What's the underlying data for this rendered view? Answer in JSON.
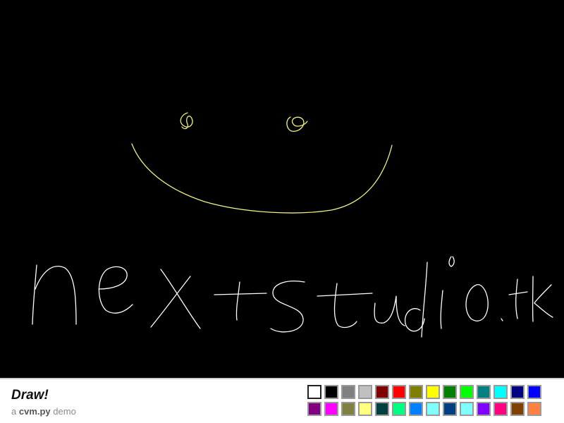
{
  "app": {
    "title": "Draw!",
    "subtitle_prefix": "a",
    "subtitle_name": "cvm.py",
    "subtitle_suffix": "demo"
  },
  "canvas": {
    "background": "#000000",
    "content": "freehand drawing"
  },
  "palette": {
    "selected_index": 0,
    "colors": [
      "#ffffff",
      "#000000",
      "#808080",
      "#c0c0c0",
      "#800000",
      "#ff0000",
      "#808000",
      "#ffff00",
      "#008000",
      "#00ff00",
      "#008080",
      "#00ffff",
      "#000080",
      "#0000ff",
      "#800080",
      "#ff00ff",
      "#808040",
      "#ffff80",
      "#004040",
      "#00ff80",
      "#0080ff",
      "#80ffff",
      "#004080",
      "#80ffff",
      "#8000ff",
      "#ff0080",
      "#804000",
      "#ff8040"
    ]
  }
}
